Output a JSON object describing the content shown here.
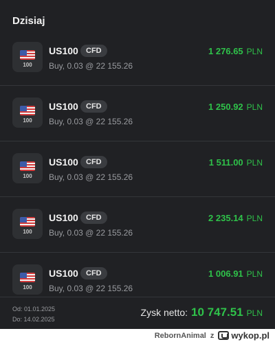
{
  "section_title": "Dzisiaj",
  "positions": [
    {
      "symbol": "US100",
      "badge": "CFD",
      "thumb_label": "100",
      "detail": "Buy, 0.03 @ 22 155.26",
      "amount": "1 276.65",
      "currency": "PLN"
    },
    {
      "symbol": "US100",
      "badge": "CFD",
      "thumb_label": "100",
      "detail": "Buy, 0.03 @ 22 155.26",
      "amount": "1 250.92",
      "currency": "PLN"
    },
    {
      "symbol": "US100",
      "badge": "CFD",
      "thumb_label": "100",
      "detail": "Buy, 0.03 @ 22 155.26",
      "amount": "1 511.00",
      "currency": "PLN"
    },
    {
      "symbol": "US100",
      "badge": "CFD",
      "thumb_label": "100",
      "detail": "Buy, 0.03 @ 22 155.26",
      "amount": "2 235.14",
      "currency": "PLN"
    },
    {
      "symbol": "US100",
      "badge": "CFD",
      "thumb_label": "100",
      "detail": "Buy, 0.03 @ 22 155.26",
      "amount": "1 006.91",
      "currency": "PLN"
    }
  ],
  "footer": {
    "date_from": "Od: 01.01.2025",
    "date_to": "Do: 14.02.2025",
    "net_label": "Zysk netto:",
    "net_value": "10 747.51",
    "net_currency": "PLN"
  },
  "watermark": {
    "user": "RebornAnimal",
    "separator": "z",
    "site": "wykop.pl"
  },
  "colors": {
    "background": "#202124",
    "profit_green": "#2fc24a",
    "badge_bg": "#3a3c40"
  },
  "icons": [
    "us-flag-icon",
    "wykop-logo-icon"
  ]
}
